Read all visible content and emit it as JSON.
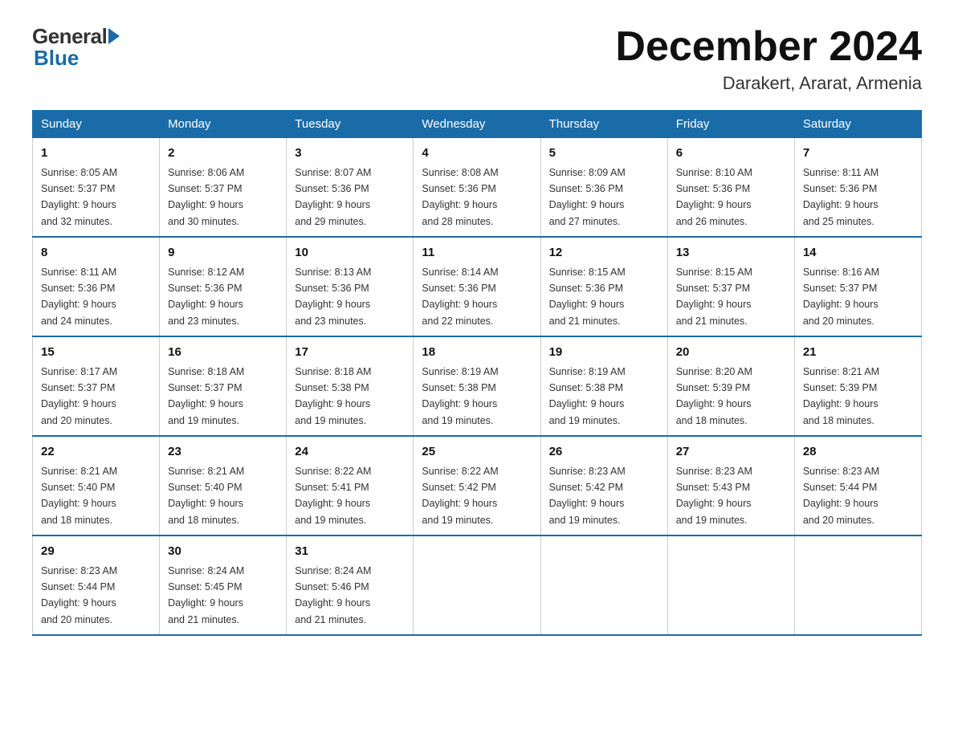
{
  "logo": {
    "general": "General",
    "blue": "Blue"
  },
  "title": {
    "month_year": "December 2024",
    "location": "Darakert, Ararat, Armenia"
  },
  "days_of_week": [
    "Sunday",
    "Monday",
    "Tuesday",
    "Wednesday",
    "Thursday",
    "Friday",
    "Saturday"
  ],
  "weeks": [
    [
      {
        "day": "1",
        "sunrise": "8:05 AM",
        "sunset": "5:37 PM",
        "daylight": "9 hours and 32 minutes."
      },
      {
        "day": "2",
        "sunrise": "8:06 AM",
        "sunset": "5:37 PM",
        "daylight": "9 hours and 30 minutes."
      },
      {
        "day": "3",
        "sunrise": "8:07 AM",
        "sunset": "5:36 PM",
        "daylight": "9 hours and 29 minutes."
      },
      {
        "day": "4",
        "sunrise": "8:08 AM",
        "sunset": "5:36 PM",
        "daylight": "9 hours and 28 minutes."
      },
      {
        "day": "5",
        "sunrise": "8:09 AM",
        "sunset": "5:36 PM",
        "daylight": "9 hours and 27 minutes."
      },
      {
        "day": "6",
        "sunrise": "8:10 AM",
        "sunset": "5:36 PM",
        "daylight": "9 hours and 26 minutes."
      },
      {
        "day": "7",
        "sunrise": "8:11 AM",
        "sunset": "5:36 PM",
        "daylight": "9 hours and 25 minutes."
      }
    ],
    [
      {
        "day": "8",
        "sunrise": "8:11 AM",
        "sunset": "5:36 PM",
        "daylight": "9 hours and 24 minutes."
      },
      {
        "day": "9",
        "sunrise": "8:12 AM",
        "sunset": "5:36 PM",
        "daylight": "9 hours and 23 minutes."
      },
      {
        "day": "10",
        "sunrise": "8:13 AM",
        "sunset": "5:36 PM",
        "daylight": "9 hours and 23 minutes."
      },
      {
        "day": "11",
        "sunrise": "8:14 AM",
        "sunset": "5:36 PM",
        "daylight": "9 hours and 22 minutes."
      },
      {
        "day": "12",
        "sunrise": "8:15 AM",
        "sunset": "5:36 PM",
        "daylight": "9 hours and 21 minutes."
      },
      {
        "day": "13",
        "sunrise": "8:15 AM",
        "sunset": "5:37 PM",
        "daylight": "9 hours and 21 minutes."
      },
      {
        "day": "14",
        "sunrise": "8:16 AM",
        "sunset": "5:37 PM",
        "daylight": "9 hours and 20 minutes."
      }
    ],
    [
      {
        "day": "15",
        "sunrise": "8:17 AM",
        "sunset": "5:37 PM",
        "daylight": "9 hours and 20 minutes."
      },
      {
        "day": "16",
        "sunrise": "8:18 AM",
        "sunset": "5:37 PM",
        "daylight": "9 hours and 19 minutes."
      },
      {
        "day": "17",
        "sunrise": "8:18 AM",
        "sunset": "5:38 PM",
        "daylight": "9 hours and 19 minutes."
      },
      {
        "day": "18",
        "sunrise": "8:19 AM",
        "sunset": "5:38 PM",
        "daylight": "9 hours and 19 minutes."
      },
      {
        "day": "19",
        "sunrise": "8:19 AM",
        "sunset": "5:38 PM",
        "daylight": "9 hours and 19 minutes."
      },
      {
        "day": "20",
        "sunrise": "8:20 AM",
        "sunset": "5:39 PM",
        "daylight": "9 hours and 18 minutes."
      },
      {
        "day": "21",
        "sunrise": "8:21 AM",
        "sunset": "5:39 PM",
        "daylight": "9 hours and 18 minutes."
      }
    ],
    [
      {
        "day": "22",
        "sunrise": "8:21 AM",
        "sunset": "5:40 PM",
        "daylight": "9 hours and 18 minutes."
      },
      {
        "day": "23",
        "sunrise": "8:21 AM",
        "sunset": "5:40 PM",
        "daylight": "9 hours and 18 minutes."
      },
      {
        "day": "24",
        "sunrise": "8:22 AM",
        "sunset": "5:41 PM",
        "daylight": "9 hours and 19 minutes."
      },
      {
        "day": "25",
        "sunrise": "8:22 AM",
        "sunset": "5:42 PM",
        "daylight": "9 hours and 19 minutes."
      },
      {
        "day": "26",
        "sunrise": "8:23 AM",
        "sunset": "5:42 PM",
        "daylight": "9 hours and 19 minutes."
      },
      {
        "day": "27",
        "sunrise": "8:23 AM",
        "sunset": "5:43 PM",
        "daylight": "9 hours and 19 minutes."
      },
      {
        "day": "28",
        "sunrise": "8:23 AM",
        "sunset": "5:44 PM",
        "daylight": "9 hours and 20 minutes."
      }
    ],
    [
      {
        "day": "29",
        "sunrise": "8:23 AM",
        "sunset": "5:44 PM",
        "daylight": "9 hours and 20 minutes."
      },
      {
        "day": "30",
        "sunrise": "8:24 AM",
        "sunset": "5:45 PM",
        "daylight": "9 hours and 21 minutes."
      },
      {
        "day": "31",
        "sunrise": "8:24 AM",
        "sunset": "5:46 PM",
        "daylight": "9 hours and 21 minutes."
      },
      null,
      null,
      null,
      null
    ]
  ]
}
